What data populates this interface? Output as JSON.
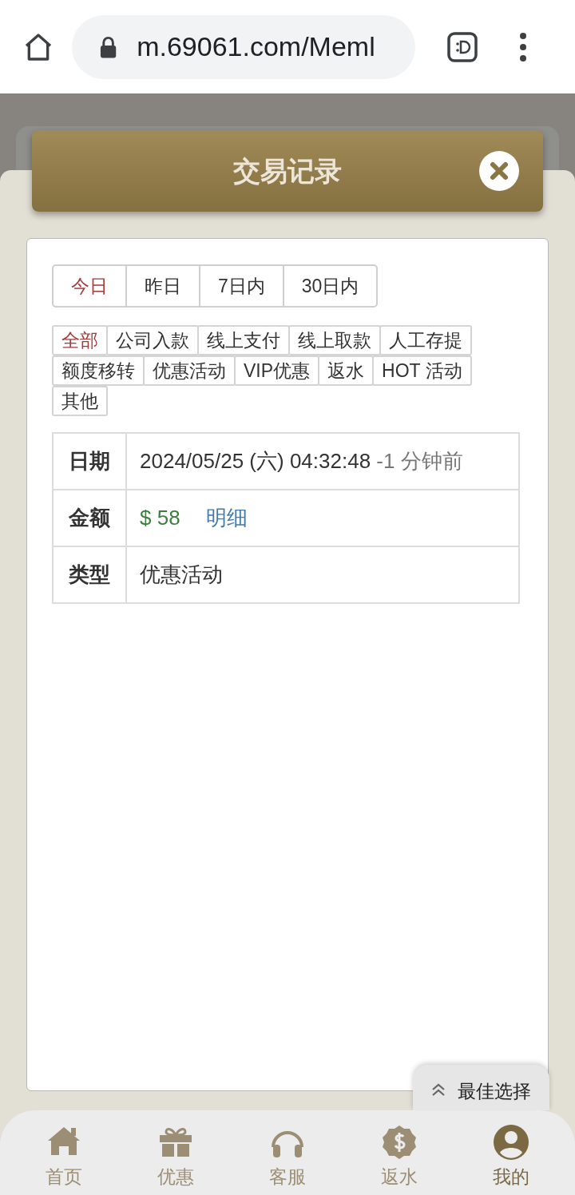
{
  "browser": {
    "url": "m.69061.com/Meml"
  },
  "dialog": {
    "title": "交易记录"
  },
  "periods": [
    {
      "label": "今日",
      "selected": true
    },
    {
      "label": "昨日",
      "selected": false
    },
    {
      "label": "7日内",
      "selected": false
    },
    {
      "label": "30日内",
      "selected": false
    }
  ],
  "categories": [
    {
      "label": "全部",
      "selected": true
    },
    {
      "label": "公司入款",
      "selected": false
    },
    {
      "label": "线上支付",
      "selected": false
    },
    {
      "label": "线上取款",
      "selected": false
    },
    {
      "label": "人工存提",
      "selected": false
    },
    {
      "label": "额度移转",
      "selected": false
    },
    {
      "label": "优惠活动",
      "selected": false
    },
    {
      "label": "VIP优惠",
      "selected": false
    },
    {
      "label": "返水",
      "selected": false
    },
    {
      "label": "HOT 活动",
      "selected": false
    },
    {
      "label": "其他",
      "selected": false
    }
  ],
  "record": {
    "date_label": "日期",
    "date": "2024/05/25 (六) 04:32:48",
    "ago": "-1 分钟前",
    "amount_label": "金额",
    "amount": "$ 58",
    "detail_link": "明细",
    "type_label": "类型",
    "type": "优惠活动"
  },
  "floating_button": {
    "label": "最佳选择"
  },
  "bottom_nav": [
    {
      "kind": "home",
      "label": "首页",
      "selected": false
    },
    {
      "kind": "gift",
      "label": "优惠",
      "selected": false
    },
    {
      "kind": "headset",
      "label": "客服",
      "selected": false
    },
    {
      "kind": "rebate",
      "label": "返水",
      "selected": false
    },
    {
      "kind": "user",
      "label": "我的",
      "selected": true
    }
  ]
}
